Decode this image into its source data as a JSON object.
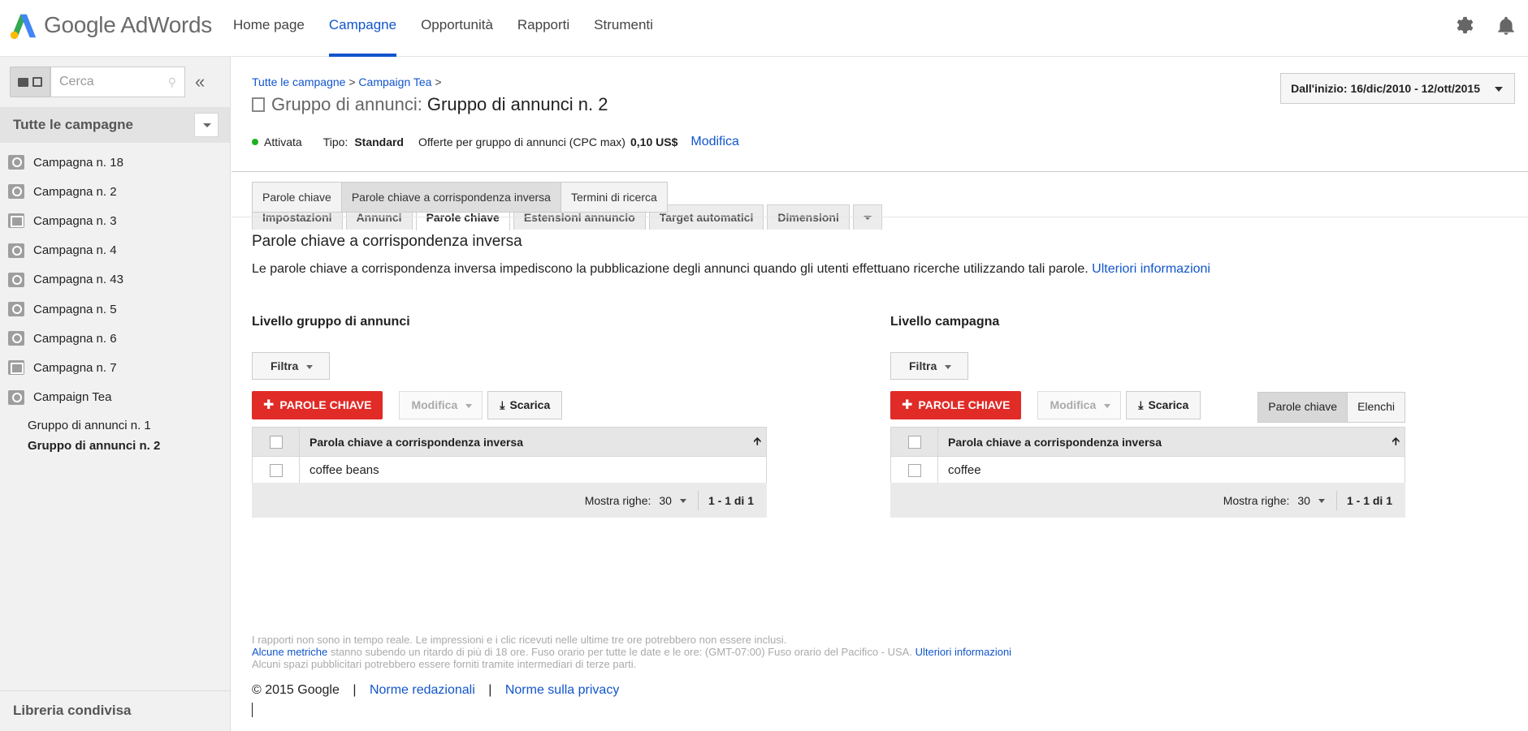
{
  "header": {
    "logo_text": "Google AdWords",
    "nav": [
      "Home page",
      "Campagne",
      "Opportunità",
      "Rapporti",
      "Strumenti"
    ],
    "active_nav": "Campagne",
    "icons": [
      "gear-icon",
      "bell-icon"
    ],
    "brand_colors": {
      "blue": "#4285f4",
      "green": "#34a853",
      "yellow": "#fbbc05"
    }
  },
  "sidebar": {
    "search_placeholder": "Cerca",
    "all_campaigns": "Tutte le campagne",
    "campaigns": [
      {
        "label": "Campagna n. 18",
        "icon": "search-display-icon"
      },
      {
        "label": "Campagna n. 2",
        "icon": "search-display-icon"
      },
      {
        "label": "Campagna n. 3",
        "icon": "display-icon"
      },
      {
        "label": "Campagna n. 4",
        "icon": "search-icon"
      },
      {
        "label": "Campagna n. 43",
        "icon": "search-icon"
      },
      {
        "label": "Campagna n. 5",
        "icon": "search-display-icon"
      },
      {
        "label": "Campagna n. 6",
        "icon": "search-icon"
      },
      {
        "label": "Campagna n. 7",
        "icon": "display-icon"
      },
      {
        "label": "Campaign Tea",
        "icon": "search-icon"
      }
    ],
    "ad_groups": [
      "Gruppo di annunci n. 1",
      "Gruppo di annunci n. 2"
    ],
    "selected_ad_group": "Gruppo di annunci n. 2",
    "shared_library": "Libreria condivisa"
  },
  "main": {
    "breadcrumb": {
      "all": "Tutte le campagne",
      "sep1": ">",
      "campaign": "Campaign Tea",
      "sep2": ">"
    },
    "title_prefix": "Gruppo di annunci:",
    "title": "Gruppo di annunci n. 2",
    "date_range": "Dall'inizio: 16/dic/2010 - 12/ott/2015",
    "status": {
      "state": "Attivata",
      "type_label": "Tipo:",
      "type_value": "Standard",
      "bid_label": "Offerte per gruppo di annunci (CPC max)",
      "bid_value": "0,10 US$",
      "edit": "Modifica",
      "state_color": "#1eb11e"
    },
    "tabs": [
      "Impostazioni",
      "Annunci",
      "Parole chiave",
      "Estensioni annuncio",
      "Target automatici",
      "Dimensioni"
    ],
    "active_tab": "Parole chiave",
    "subtabs": [
      "Parole chiave",
      "Parole chiave a corrispondenza inversa",
      "Termini di ricerca"
    ],
    "active_subtab": "Parole chiave a corrispondenza inversa",
    "section_title": "Parole chiave a corrispondenza inversa",
    "section_desc": "Le parole chiave a corrispondenza inversa impediscono la pubblicazione degli annunci quando gli utenti effettuano ricerche utilizzando tali parole.",
    "more_info": "Ulteriori informazioni"
  },
  "panels": {
    "left": {
      "heading": "Livello gruppo di annunci",
      "filter": "Filtra",
      "add": "PAROLE CHIAVE",
      "modify": "Modifica",
      "download": "Scarica",
      "column": "Parola chiave a corrispondenza inversa",
      "rows": [
        "coffee beans"
      ],
      "rows_label": "Mostra righe:",
      "rows_value": "30",
      "range": "1 - 1 di 1"
    },
    "right": {
      "heading": "Livello campagna",
      "filter": "Filtra",
      "add": "PAROLE CHIAVE",
      "modify": "Modifica",
      "download": "Scarica",
      "toggle": [
        "Parole chiave",
        "Elenchi"
      ],
      "column": "Parola chiave a corrispondenza inversa",
      "rows": [
        "coffee"
      ],
      "rows_label": "Mostra righe:",
      "rows_value": "30",
      "range": "1 - 1 di 1"
    }
  },
  "footer": {
    "line1": "I rapporti non sono in tempo reale. Le impressioni e i clic ricevuti nelle ultime tre ore potrebbero non essere inclusi.",
    "line2_link": "Alcune metriche",
    "line2": "stanno subendo un ritardo di più di 18 ore. Fuso orario per tutte le date e le ore: (GMT-07:00) Fuso orario del Pacifico - USA.",
    "line2_more": "Ulteriori informazioni",
    "line3": "Alcuni spazi pubblicitari potrebbero essere forniti tramite intermediari di terze parti.",
    "copyright": "© 2015 Google",
    "pipe": "|",
    "policy": "Norme redazionali",
    "privacy": "Norme sulla privacy"
  }
}
